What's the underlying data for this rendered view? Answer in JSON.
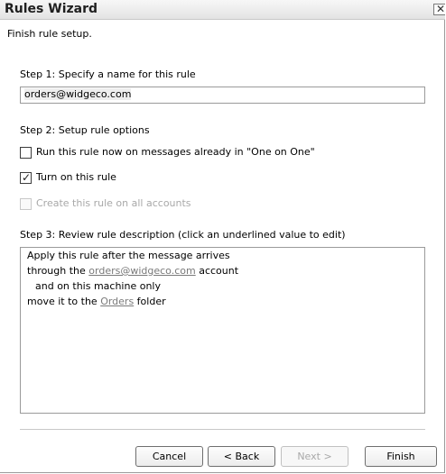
{
  "window": {
    "title": "Rules Wizard",
    "close_glyph": "✕"
  },
  "intro": "Finish rule setup.",
  "step1": {
    "label": "Step 1: Specify a name for this rule",
    "name_value": "orders@widgeco.com"
  },
  "step2": {
    "label": "Step 2: Setup rule options",
    "options": [
      {
        "label": "Run this rule now on messages already in \"One on One\"",
        "checked": false,
        "enabled": true
      },
      {
        "label": "Turn on this rule",
        "checked": true,
        "enabled": true
      },
      {
        "label": "Create this rule on all accounts",
        "checked": false,
        "enabled": false
      }
    ]
  },
  "step3": {
    "label": "Step 3: Review rule description (click an underlined value to edit)",
    "description": {
      "line1": "Apply this rule after the message arrives",
      "line2_prefix": "through the ",
      "line2_link": "orders@widgeco.com",
      "line2_suffix": " account",
      "line3": "and on this machine only",
      "line4_prefix": "move it to the ",
      "line4_link": "Orders",
      "line4_suffix": " folder"
    }
  },
  "buttons": {
    "cancel": "Cancel",
    "back": "< Back",
    "next": "Next >",
    "finish": "Finish"
  },
  "icons": {
    "checkmark": "✓"
  }
}
